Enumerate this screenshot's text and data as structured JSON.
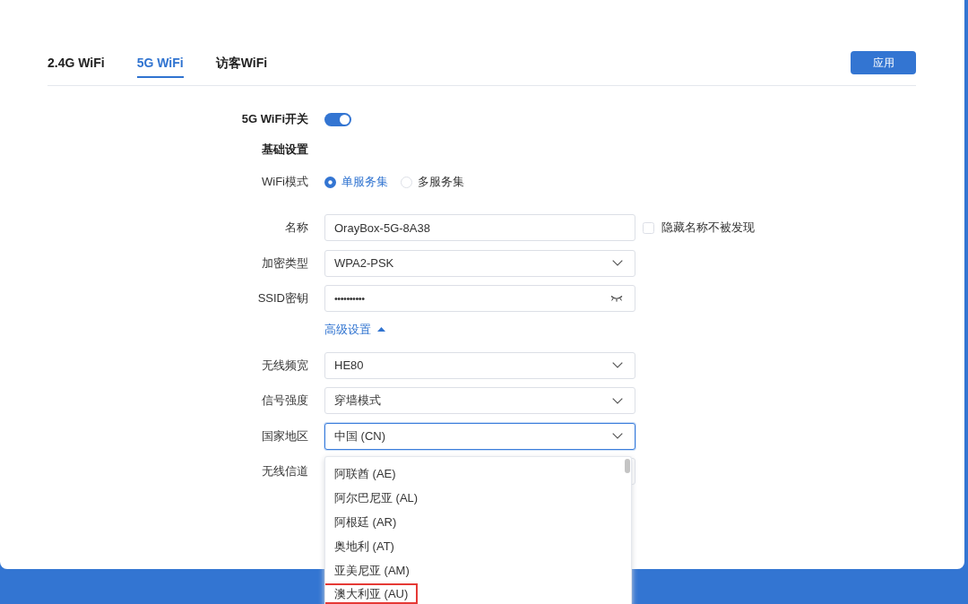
{
  "tabs": [
    {
      "label": "2.4G WiFi",
      "selected": false
    },
    {
      "label": "5G WiFi",
      "selected": true
    },
    {
      "label": "访客WiFi",
      "selected": false
    }
  ],
  "apply_button": {
    "label": "应用"
  },
  "form": {
    "rows": [
      {
        "kind": "switch",
        "label": "5G WiFi开关",
        "on": true
      },
      {
        "kind": "heading",
        "label": "基础设置"
      },
      {
        "kind": "radio",
        "label": "WiFi模式",
        "options": [
          {
            "label": "单服务集",
            "selected": true
          },
          {
            "label": "多服务集",
            "selected": false
          }
        ]
      },
      {
        "kind": "text",
        "label": "名称",
        "value": "OrayBox-5G-8A38",
        "checkbox": {
          "label": "隐藏名称不被发现",
          "checked": false
        }
      },
      {
        "kind": "select",
        "label": "加密类型",
        "value": "WPA2-PSK",
        "open": false
      },
      {
        "kind": "password",
        "label": "SSID密钥",
        "value": "••••••••••"
      },
      {
        "kind": "link",
        "label": "高级设置",
        "expanded": true
      },
      {
        "kind": "select",
        "label": "无线频宽",
        "value": "HE80",
        "open": false
      },
      {
        "kind": "select",
        "label": "信号强度",
        "value": "穿墙模式",
        "open": false
      },
      {
        "kind": "select",
        "label": "国家地区",
        "value": "中国 (CN)",
        "open": true,
        "options": [
          {
            "label": "阿联酋 (AE)",
            "selected": false,
            "highlighted": false
          },
          {
            "label": "阿尔巴尼亚 (AL)",
            "selected": false,
            "highlighted": false
          },
          {
            "label": "阿根廷 (AR)",
            "selected": false,
            "highlighted": false
          },
          {
            "label": "奥地利 (AT)",
            "selected": false,
            "highlighted": false
          },
          {
            "label": "亚美尼亚 (AM)",
            "selected": false,
            "highlighted": false
          },
          {
            "label": "澳大利亚 (AU)",
            "selected": false,
            "highlighted": true
          }
        ]
      },
      {
        "kind": "select",
        "label": "无线信道",
        "open": false
      }
    ]
  }
}
